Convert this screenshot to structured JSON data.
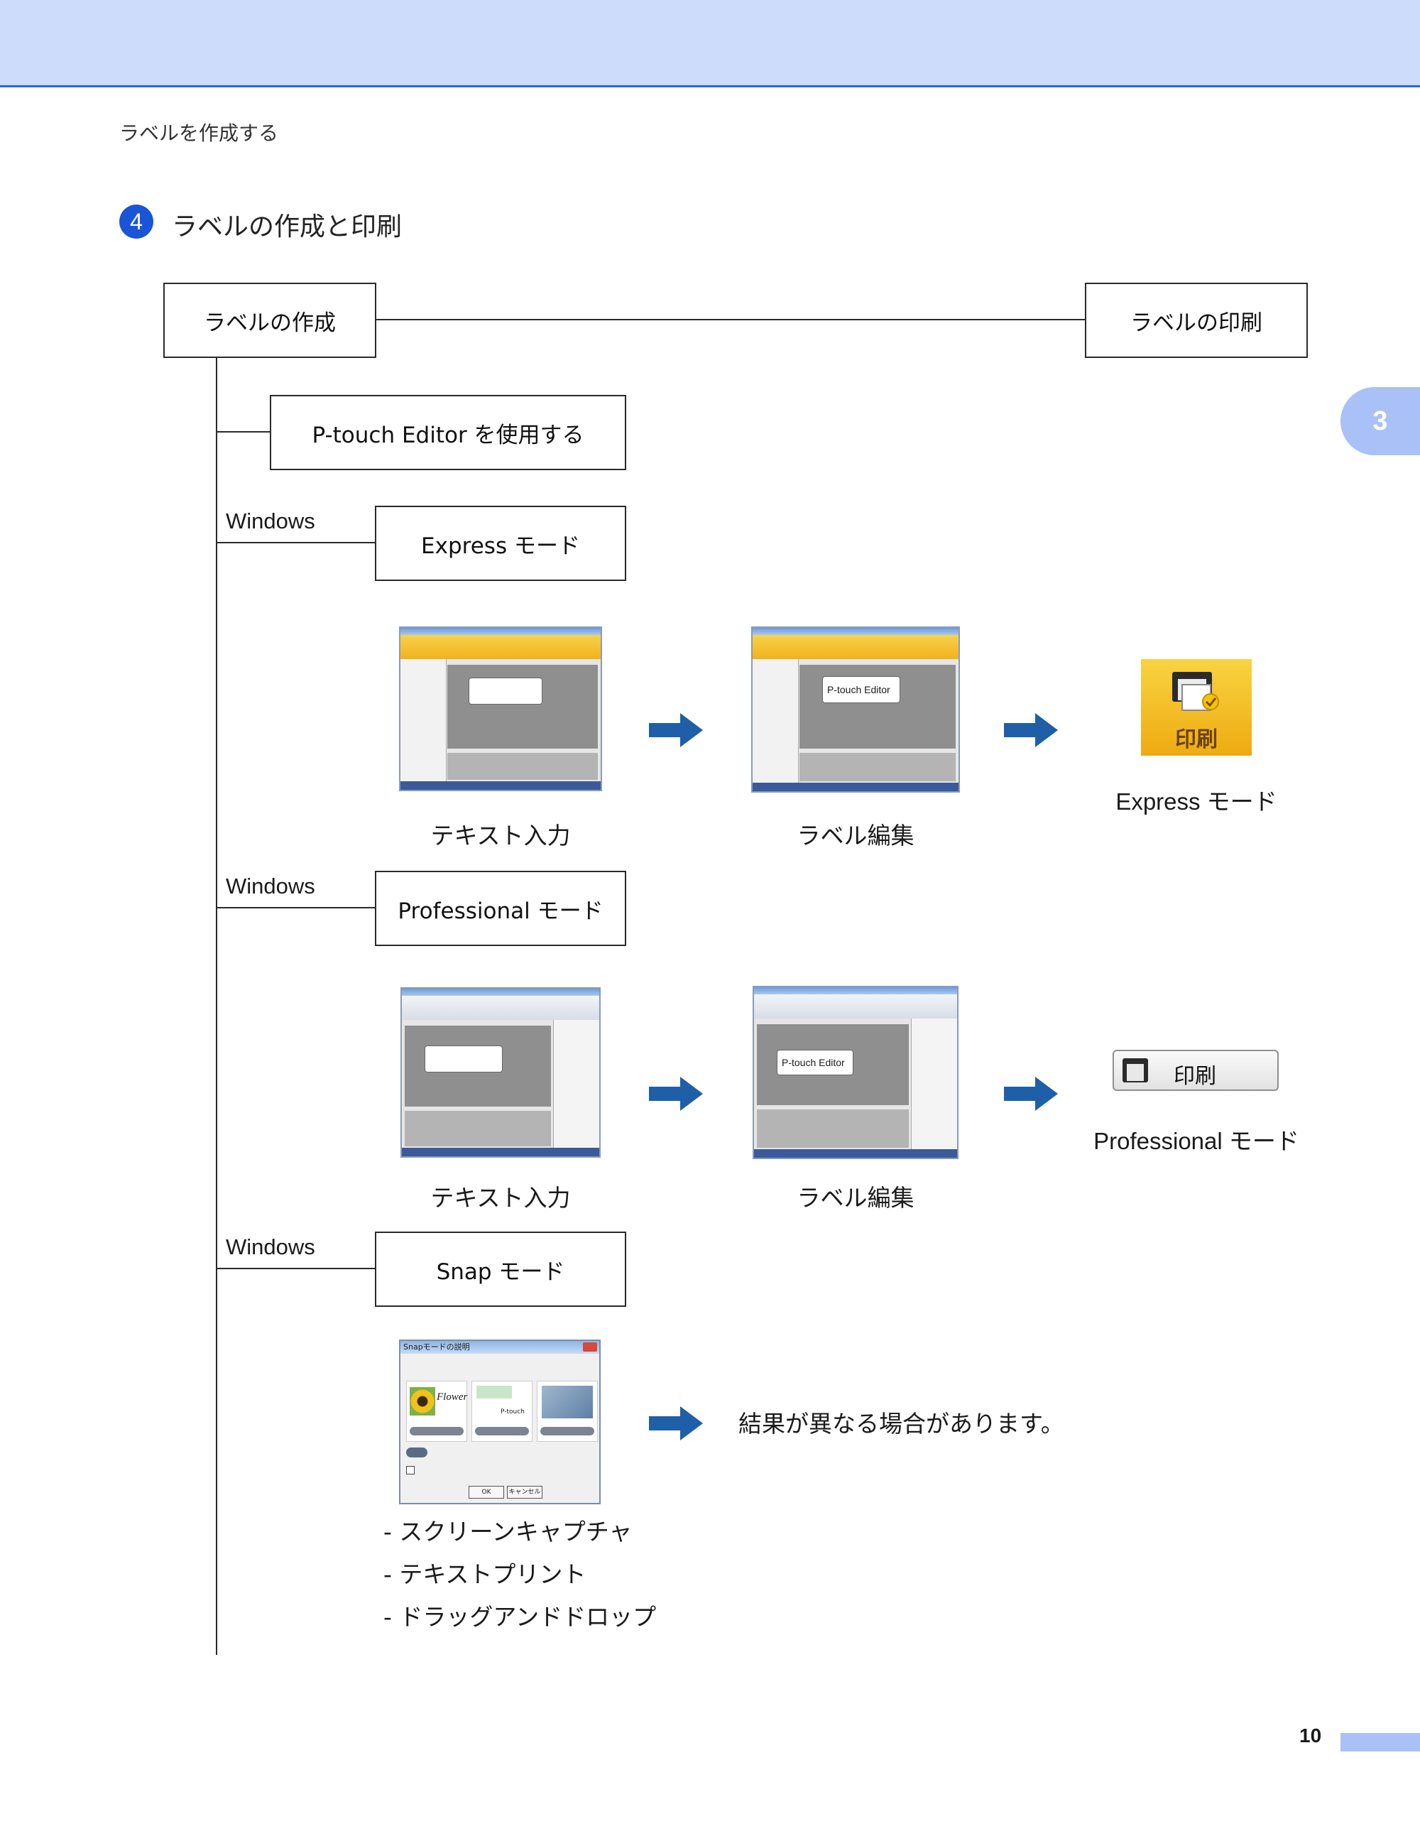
{
  "breadcrumb": "ラベルを作成する",
  "section": {
    "number": "4",
    "title": "ラベルの作成と印刷"
  },
  "flow": {
    "create_box": "ラベルの作成",
    "print_box": "ラベルの印刷",
    "editor_box": "P-touch Editor を使用する",
    "express": {
      "os_label": "Windows",
      "mode_box": "Express モード",
      "step1_caption": "テキスト入力",
      "step2_caption": "ラベル編集",
      "step2_label_text": "P-touch Editor",
      "print_icon_text": "印刷",
      "result_caption": "Express モード"
    },
    "professional": {
      "os_label": "Windows",
      "mode_box": "Professional モード",
      "step1_caption": "テキスト入力",
      "step2_caption": "ラベル編集",
      "step2_label_text": "P-touch Editor",
      "print_button_text": "印刷",
      "result_caption": "Professional モード"
    },
    "snap": {
      "os_label": "Windows",
      "mode_box": "Snap モード",
      "dialog_title": "Snapモードの説明",
      "panel_texts": [
        "Flower",
        "P-touch"
      ],
      "dialog_ok": "OK",
      "dialog_cancel": "キャンセル",
      "result_text": "結果が異なる場合があります。",
      "features": [
        "- スクリーンキャプチャ",
        "- テキストプリント",
        "- ドラッグアンドドロップ"
      ]
    }
  },
  "chapter_tab": "3",
  "page_number": "10",
  "colors": {
    "accent": "#1a55d8",
    "arrow": "#1f5fa8",
    "band": "#cddcfa",
    "tab": "#a9c1f6"
  }
}
